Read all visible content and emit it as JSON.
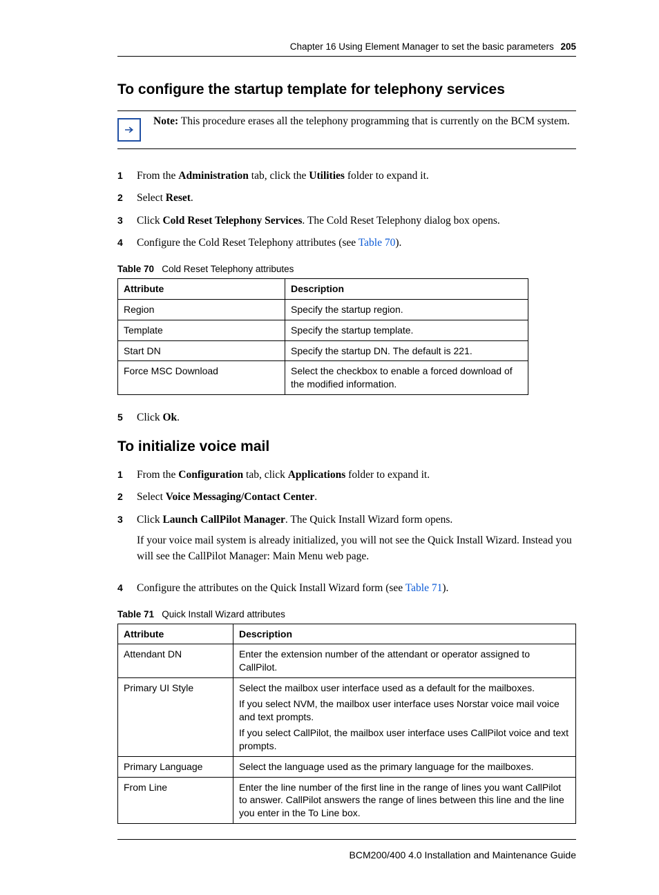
{
  "header": {
    "chapter": "Chapter 16  Using Element Manager to set the basic parameters",
    "page": "205"
  },
  "section1": {
    "title": "To configure the startup template for telephony services",
    "note_prefix": "Note:",
    "note_body": " This procedure erases all the telephony programming that is currently on the BCM system.",
    "steps": {
      "1": {
        "pre": "From the ",
        "b1": "Administration",
        "mid1": " tab, click the ",
        "b2": "Utilities",
        "post": " folder to expand it."
      },
      "2": {
        "pre": "Select ",
        "b1": "Reset",
        "post": "."
      },
      "3": {
        "pre": "Click ",
        "b1": "Cold Reset Telephony Services",
        "post": ". The Cold Reset Telephony dialog box opens."
      },
      "4": {
        "pre": "Configure the Cold Reset Telephony attributes (see ",
        "link": "Table 70",
        "post": ")."
      },
      "5": {
        "pre": "Click ",
        "b1": "Ok",
        "post": "."
      }
    }
  },
  "table70": {
    "caption_num": "Table 70",
    "caption_title": "Cold Reset Telephony attributes",
    "head": {
      "attr": "Attribute",
      "desc": "Description"
    },
    "rows": [
      {
        "attr": "Region",
        "desc": "Specify the startup region."
      },
      {
        "attr": "Template",
        "desc": "Specify the startup template."
      },
      {
        "attr": "Start DN",
        "desc": "Specify the startup DN. The default is 221."
      },
      {
        "attr": "Force MSC Download",
        "desc": "Select the checkbox to enable a forced download of the modified information."
      }
    ]
  },
  "section2": {
    "title": "To initialize voice mail",
    "steps": {
      "1": {
        "pre": "From the ",
        "b1": "Configuration",
        "mid1": " tab, click ",
        "b2": "Applications",
        "post": " folder to expand it."
      },
      "2": {
        "pre": "Select ",
        "b1": "Voice Messaging/Contact Center",
        "post": "."
      },
      "3": {
        "pre": "Click ",
        "b1": "Launch CallPilot Manager",
        "post": ". The Quick Install Wizard form opens."
      },
      "s3_body": "If your voice mail system is already initialized, you will not see the Quick Install Wizard. Instead you will see the CallPilot Manager: Main Menu web page.",
      "4": {
        "pre": "Configure the attributes on the Quick Install Wizard form (see ",
        "link": "Table 71",
        "post": ")."
      }
    }
  },
  "table71": {
    "caption_num": "Table 71",
    "caption_title": "Quick Install Wizard attributes",
    "head": {
      "attr": "Attribute",
      "desc": "Description"
    },
    "rows": {
      "0": {
        "attr": "Attendant DN",
        "desc": "Enter the extension number of the attendant or operator assigned to CallPilot."
      },
      "1": {
        "attr": "Primary UI Style",
        "p1": "Select the mailbox user interface used as a default for the mailboxes.",
        "p2": "If you select NVM, the mailbox user interface uses Norstar voice mail voice and text prompts.",
        "p3": "If you select CallPilot, the mailbox user interface uses CallPilot voice and text prompts."
      },
      "2": {
        "attr": "Primary Language",
        "desc": "Select the language used as the primary language for the mailboxes."
      },
      "3": {
        "attr": "From Line",
        "desc": "Enter the line number of the first line in the range of lines you want CallPilot to answer. CallPilot answers the range of lines between this line and the line you enter in the To Line box."
      }
    }
  },
  "footer": "BCM200/400 4.0 Installation and Maintenance Guide"
}
